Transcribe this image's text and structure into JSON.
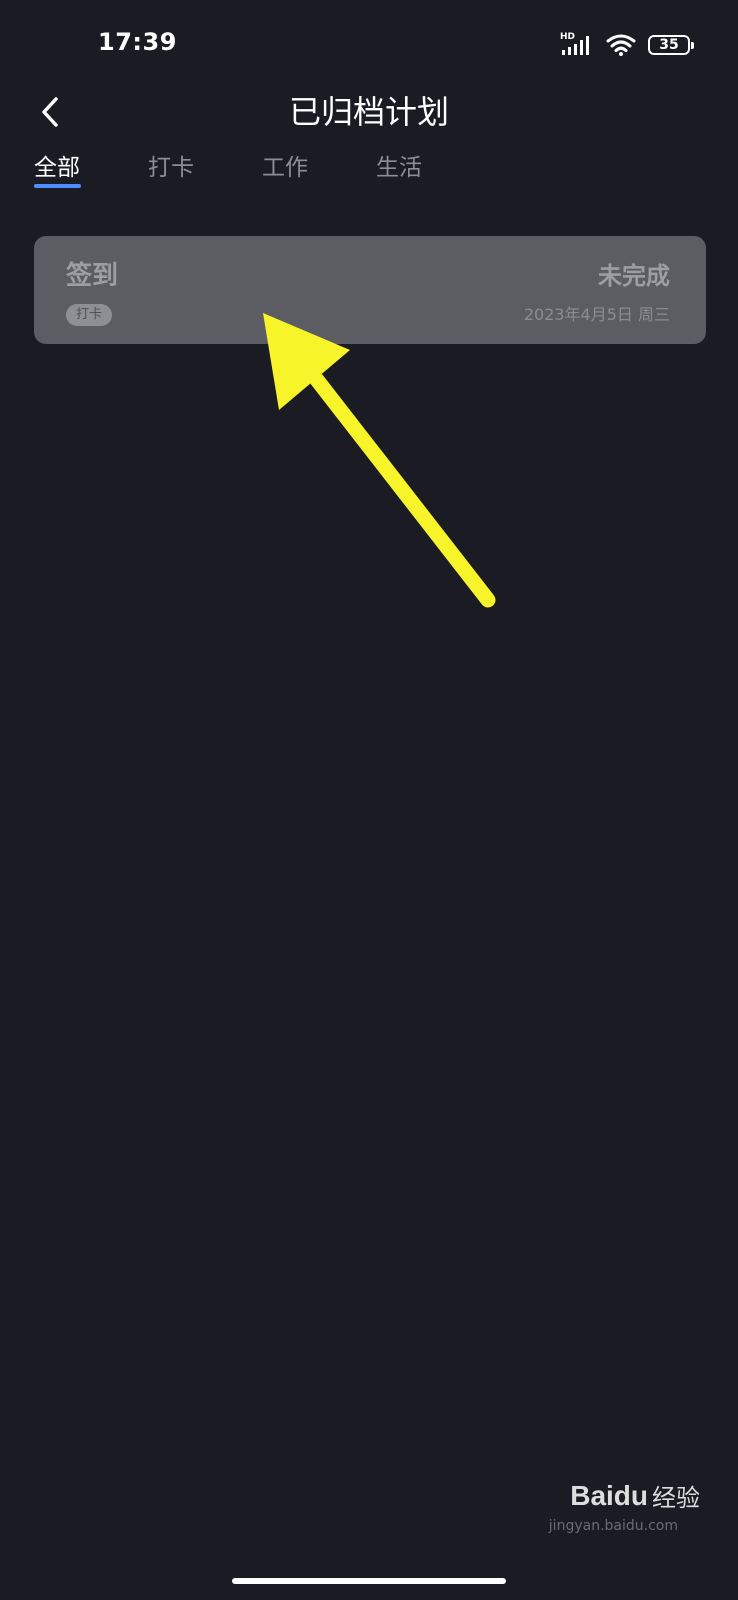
{
  "status_bar": {
    "time": "17:39",
    "network_label": "HD",
    "battery_level": "35",
    "icons": [
      "signal-icon",
      "wifi-icon",
      "battery-icon"
    ]
  },
  "header": {
    "back_icon": "chevron-left-icon",
    "title": "已归档计划"
  },
  "tabs": [
    {
      "label": "全部",
      "active": true
    },
    {
      "label": "打卡",
      "active": false
    },
    {
      "label": "工作",
      "active": false
    },
    {
      "label": "生活",
      "active": false
    }
  ],
  "plans": [
    {
      "title": "签到",
      "tag": "打卡",
      "status": "未完成",
      "date": "2023年4月5日 周三"
    }
  ],
  "watermark": {
    "logo": "Baidu",
    "text": "经验",
    "sub": "jingyan.baidu.com"
  },
  "colors": {
    "background": "#1b1b23",
    "card": "#5c5d63",
    "accent": "#4d8dff",
    "annotation_arrow": "#f7f52a"
  }
}
